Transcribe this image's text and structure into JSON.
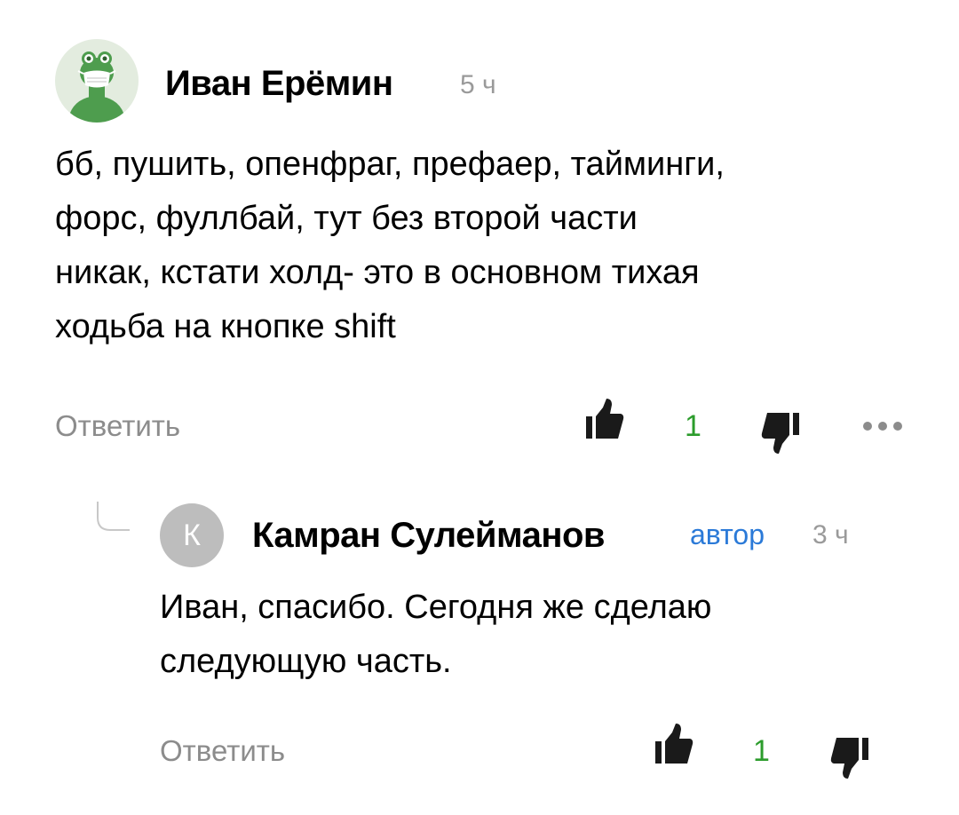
{
  "comments": [
    {
      "author": "Иван Ерёмин",
      "time": "5 ч",
      "text": [
        "бб, пушить, опенфраг, префаер, тайминги,",
        "форс, фуллбай, тут без второй части",
        "никак, кстати холд- это в основном тихая",
        "ходьба на кнопке shift"
      ],
      "reply_label": "Ответить",
      "likes": "1",
      "avatar_icon": "frog-in-mask-icon"
    },
    {
      "author": "Камран Сулейманов",
      "badge": "автор",
      "time": "3 ч",
      "text": [
        "Иван, спасибо. Сегодня же сделаю",
        "следующую часть."
      ],
      "reply_label": "Ответить",
      "likes": "1",
      "avatar_letter": "К"
    }
  ],
  "colors": {
    "like_count": "#2c9c2c",
    "author_badge": "#2b7ad8",
    "muted": "#8c8c8c"
  }
}
